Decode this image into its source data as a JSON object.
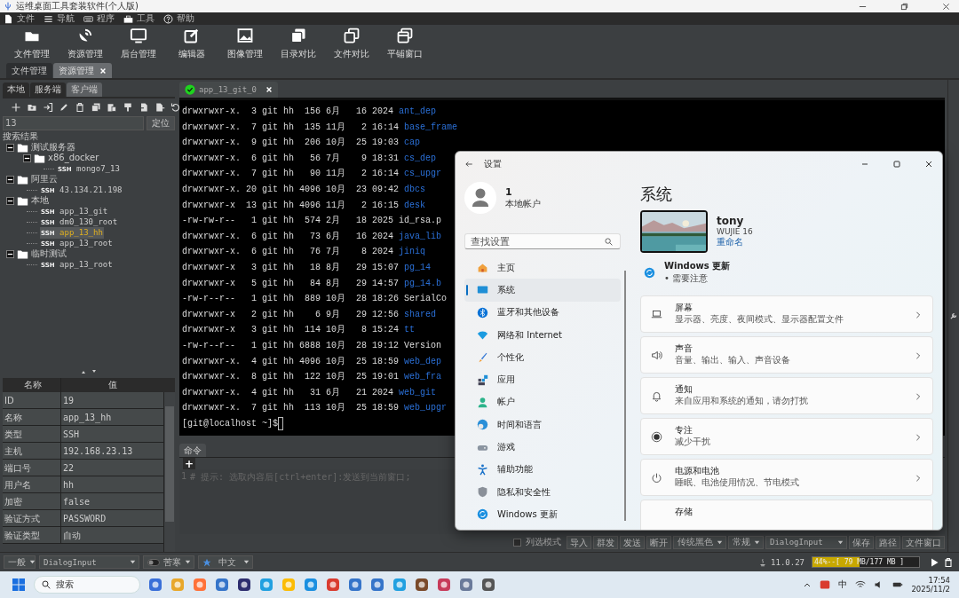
{
  "window": {
    "title": "运维桌面工具套装软件(个人版)"
  },
  "menu": [
    "文件",
    "导航",
    "程序",
    "工具",
    "帮助"
  ],
  "toolbar": [
    "文件管理",
    "资源管理",
    "后台管理",
    "编辑器",
    "图像管理",
    "目录对比",
    "文件对比",
    "平铺窗口"
  ],
  "doc_tabs": [
    {
      "label": "文件管理",
      "selected": false,
      "closable": false
    },
    {
      "label": "资源管理",
      "selected": true,
      "closable": true
    }
  ],
  "side_tabs": [
    {
      "label": "本地",
      "selected": false
    },
    {
      "label": "服务端",
      "selected": false
    },
    {
      "label": "客户端",
      "selected": true
    }
  ],
  "search": {
    "value": "13",
    "button": "定位"
  },
  "tree": {
    "title": "搜索结果",
    "items": [
      {
        "label": "测试服务器",
        "kind": "folder",
        "expanded": true,
        "children": [
          {
            "label": "x86_docker",
            "kind": "folder",
            "expanded": true,
            "children": [
              {
                "label": "mongo7_13",
                "kind": "ssh",
                "badge": "SSH",
                "selected": false
              }
            ]
          }
        ]
      },
      {
        "label": "阿里云",
        "kind": "folder",
        "expanded": true,
        "children": [
          {
            "label": "43.134.21.198",
            "kind": "ssh",
            "badge": "SSH",
            "selected": false
          }
        ]
      },
      {
        "label": "本地",
        "kind": "folder",
        "expanded": true,
        "children": [
          {
            "label": "app_13_git",
            "kind": "ssh",
            "badge": "SSH",
            "selected": false
          },
          {
            "label": "dm0_130_root",
            "kind": "ssh",
            "badge": "SSH",
            "selected": false
          },
          {
            "label": "app_13_hh",
            "kind": "ssh",
            "badge": "SSH",
            "selected": true
          },
          {
            "label": "app_13_root",
            "kind": "ssh",
            "badge": "SSH",
            "selected": false
          }
        ]
      },
      {
        "label": "临时测试",
        "kind": "folder",
        "expanded": true,
        "children": [
          {
            "label": "app_13_root",
            "kind": "ssh",
            "badge": "SSH",
            "selected": false
          }
        ]
      }
    ]
  },
  "properties": {
    "columns": [
      "名称",
      "值"
    ],
    "rows": [
      {
        "name": "ID",
        "value": "19"
      },
      {
        "name": "名称",
        "value": "app_13_hh"
      },
      {
        "name": "类型",
        "value": "SSH"
      },
      {
        "name": "主机",
        "value": "192.168.23.13"
      },
      {
        "name": "端口号",
        "value": "22"
      },
      {
        "name": "用户名",
        "value": "hh"
      },
      {
        "name": "加密",
        "value": "false"
      },
      {
        "name": "验证方式",
        "value": "PASSWORD"
      },
      {
        "name": "验证类型",
        "value": "自动"
      }
    ]
  },
  "terminal_tab": {
    "label": "app_13_git_0",
    "connected": true
  },
  "terminal": {
    "lines": [
      {
        "text": "drwxrwxr-x.  3 git hh  156 6月   16 2024 ",
        "name": "ant_dep",
        "kind": "dir"
      },
      {
        "text": "drwxrwxr-x.  7 git hh  135 11月   2 16:14 ",
        "name": "base_frame",
        "kind": "dir"
      },
      {
        "text": "drwxrwxr-x.  9 git hh  206 10月  25 19:03 ",
        "name": "cap",
        "kind": "dir"
      },
      {
        "text": "drwxrwxr-x.  6 git hh   56 7月    9 18:31 ",
        "name": "cs_dep",
        "kind": "dir"
      },
      {
        "text": "drwxrwxr-x.  7 git hh   90 11月   2 16:14 ",
        "name": "cs_upgr",
        "kind": "dir"
      },
      {
        "text": "drwxrwxr-x. 20 git hh 4096 10月  23 09:42 ",
        "name": "dbcs",
        "kind": "dir"
      },
      {
        "text": "drwxrwxr-x  13 git hh 4096 11月   2 16:15 ",
        "name": "desk",
        "kind": "dir"
      },
      {
        "text": "-rw-rw-r--   1 git hh  574 2月   18 2025 ",
        "name": "id_rsa.p",
        "kind": "file"
      },
      {
        "text": "drwxrwxr-x.  6 git hh   73 6月   16 2024 ",
        "name": "java_lib",
        "kind": "dir"
      },
      {
        "text": "drwxrwxr-x.  6 git hh   76 7月    8 2024 ",
        "name": "jiniq",
        "kind": "dir"
      },
      {
        "text": "drwxrwxr-x   3 git hh   18 8月   29 15:07 ",
        "name": "pg_14",
        "kind": "dir"
      },
      {
        "text": "drwxrwxr-x   5 git hh   84 8月   29 14:57 ",
        "name": "pg_14.b",
        "kind": "dir"
      },
      {
        "text": "-rw-r--r--   1 git hh  889 10月  28 18:26 ",
        "name": "SerialCo",
        "kind": "file"
      },
      {
        "text": "drwxrwxr-x   2 git hh    6 9月   29 12:56 ",
        "name": "shared",
        "kind": "dir"
      },
      {
        "text": "drwxrwxr-x   3 git hh  114 10月   8 15:24 ",
        "name": "tt",
        "kind": "dir"
      },
      {
        "text": "-rw-r--r--   1 git hh 6888 10月  28 19:12 ",
        "name": "Version",
        "kind": "file"
      },
      {
        "text": "drwxrwxr-x.  4 git hh 4096 10月  25 18:59 ",
        "name": "web_dep",
        "kind": "dir"
      },
      {
        "text": "drwxrwxr-x.  8 git hh  122 10月  25 19:01 ",
        "name": "web_fra",
        "kind": "dir"
      },
      {
        "text": "drwxrwxr-x.  4 git hh   31 6月   21 2024 ",
        "name": "web_git",
        "kind": "dir"
      },
      {
        "text": "drwxrwxr-x.  7 git hh  113 10月  25 18:59 ",
        "name": "web_upgr",
        "kind": "dir"
      }
    ],
    "prompt": "[git@localhost ~]$"
  },
  "command_panel": {
    "tab": "命令",
    "add": "+",
    "line_number": "1",
    "hint": "# 提示: 选取内容后[ctrl+enter]:发送到当前窗口;"
  },
  "terminal_controls": {
    "checkbox": {
      "label": "列选模式",
      "checked": false
    },
    "buttons_left": [
      "导入",
      "群发",
      "发送",
      "断开"
    ],
    "dropdowns": [
      "传统黑色",
      "常规",
      "DialogInput"
    ],
    "buttons_right": [
      "保存",
      "路径",
      "文件窗口"
    ]
  },
  "status_bar": {
    "dropdowns": [
      "一般",
      "DialogInput"
    ],
    "theme": {
      "label": "苦寒",
      "on": false
    },
    "language": "中文",
    "version": "11.0.27",
    "memory": {
      "text": "44%--[ 79 MB/177 MB ]",
      "level": 0.44
    }
  },
  "settings": {
    "title": "设置",
    "user": {
      "name": "1",
      "account": "本地帐户"
    },
    "search_placeholder": "查找设置",
    "nav": [
      {
        "label": "主页",
        "selected": false
      },
      {
        "label": "系统",
        "selected": true
      },
      {
        "label": "蓝牙和其他设备",
        "selected": false
      },
      {
        "label": "网络和 Internet",
        "selected": false
      },
      {
        "label": "个性化",
        "selected": false
      },
      {
        "label": "应用",
        "selected": false
      },
      {
        "label": "帐户",
        "selected": false
      },
      {
        "label": "时间和语言",
        "selected": false
      },
      {
        "label": "游戏",
        "selected": false
      },
      {
        "label": "辅助功能",
        "selected": false
      },
      {
        "label": "隐私和安全性",
        "selected": false
      },
      {
        "label": "Windows 更新",
        "selected": false
      }
    ],
    "heading": "系统",
    "device": {
      "name": "tony",
      "model": "WUJIE 16",
      "rename": "重命名"
    },
    "update": {
      "title": "Windows 更新",
      "status": "• 需要注意"
    },
    "cards": [
      {
        "title": "屏幕",
        "subtitle": "显示器、亮度、夜间模式、显示器配置文件"
      },
      {
        "title": "声音",
        "subtitle": "音量、输出、输入、声音设备"
      },
      {
        "title": "通知",
        "subtitle": "来自应用和系统的通知，请勿打扰"
      },
      {
        "title": "专注",
        "subtitle": "减少干扰"
      },
      {
        "title": "电源和电池",
        "subtitle": "睡眠、电池使用情况、节电模式"
      },
      {
        "title": "存储"
      }
    ]
  },
  "taskbar": {
    "search": "搜索",
    "ime": "中",
    "time": "17:54",
    "date": "2025/11/2"
  }
}
